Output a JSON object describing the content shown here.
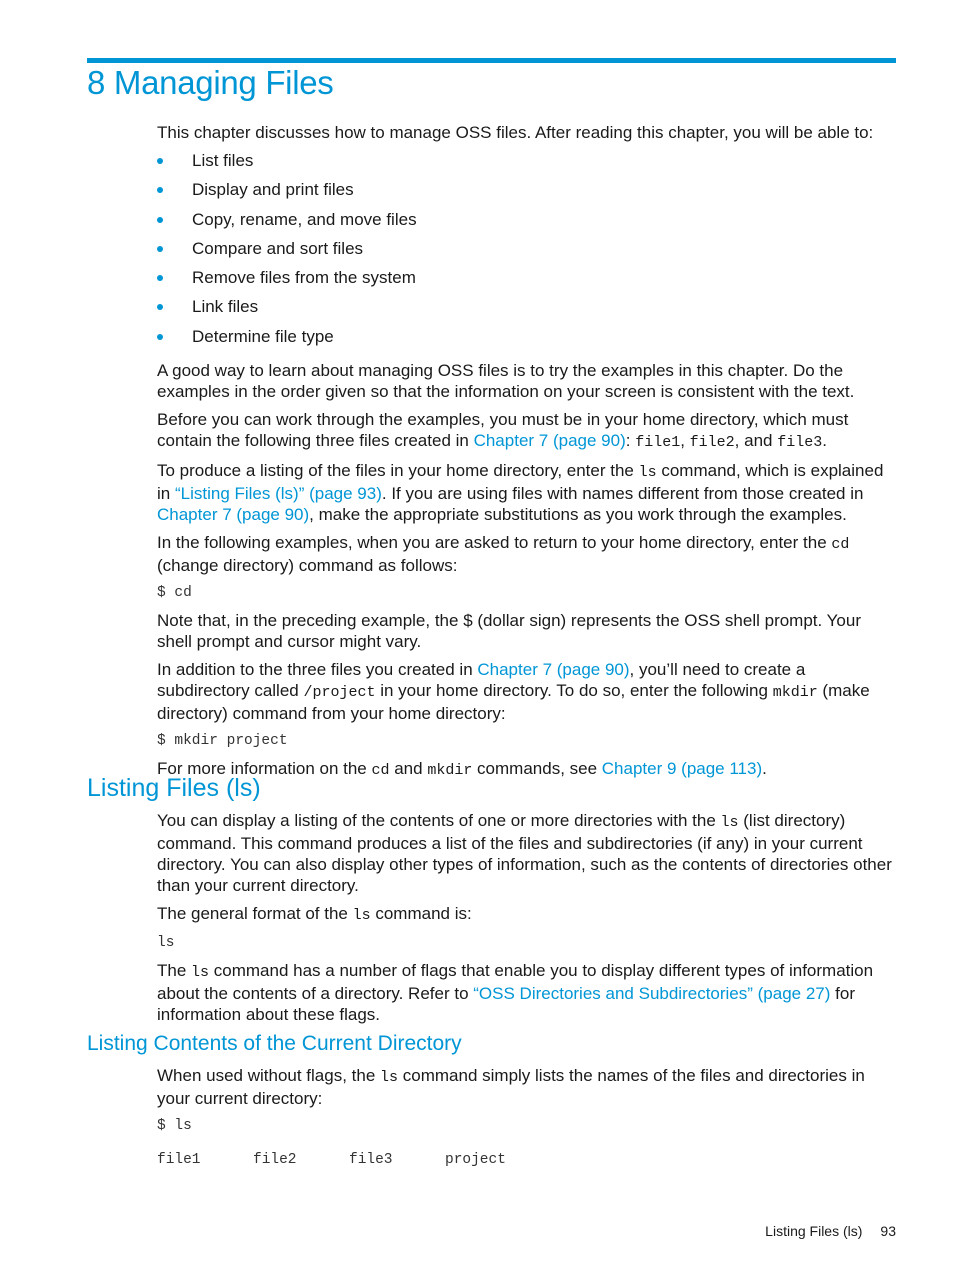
{
  "chapter": {
    "title": "8 Managing Files",
    "intro": "This chapter discusses how to manage OSS files. After reading this chapter, you will be able to:",
    "bullets": [
      "List files",
      "Display and print files",
      "Copy, rename, and move files",
      "Compare and sort files",
      "Remove files from the system",
      "Link files",
      "Determine file type"
    ],
    "p1": "A good way to learn about managing OSS files is to try the examples in this chapter. Do the examples in the order given so that the information on your screen is consistent with the text.",
    "p2": {
      "t1": "Before you can work through the examples, you must be in your home directory, which must contain the following three files created in ",
      "link1": "Chapter 7 (page 90)",
      "t2": ": ",
      "c1": "file1",
      "t3": ", ",
      "c2": "file2",
      "t4": ", and ",
      "c3": "file3",
      "t5": "."
    },
    "p3": {
      "t1": "To produce a listing of the files in your home directory, enter the ",
      "c1": "ls",
      "t2": " command, which is explained in ",
      "link1": "“Listing Files (ls)” (page 93)",
      "t3": ". If you are using files with names different from those created in ",
      "link2": "Chapter 7 (page 90)",
      "t4": ", make the appropriate substitutions as you work through the examples."
    },
    "p4": {
      "t1": "In the following examples, when you are asked to return to your home directory, enter the ",
      "c1": "cd",
      "t2": " (change directory) command as follows:"
    },
    "code1": "$ cd",
    "p5": "Note that, in the preceding example, the $ (dollar sign) represents the OSS shell prompt. Your shell prompt and cursor might vary.",
    "p6": {
      "t1": "In addition to the three files you created in ",
      "link1": "Chapter 7 (page 90)",
      "t2": ", you’ll need to create a subdirectory called ",
      "c1": "/project",
      "t3": " in your home directory. To do so, enter the following ",
      "c2": "mkdir",
      "t4": " (make directory) command from your home directory:"
    },
    "code2": "$ mkdir project",
    "p7": {
      "t1": "For more information on the ",
      "c1": "cd",
      "t2": " and ",
      "c2": "mkdir",
      "t3": " commands, see ",
      "link1": "Chapter 9 (page 113)",
      "t4": "."
    }
  },
  "section_ls": {
    "title": "Listing Files (ls)",
    "p1": {
      "t1": "You can display a listing of the contents of one or more directories with the ",
      "c1": "ls",
      "t2": " (list directory) command. This command produces a list of the files and subdirectories (if any) in your current directory. You can also display other types of information, such as the contents of directories other than your current directory."
    },
    "p2": {
      "t1": "The general format of the ",
      "c1": "ls",
      "t2": " command is:"
    },
    "code1": "ls",
    "p3": {
      "t1": "The ",
      "c1": "ls",
      "t2": " command has a number of flags that enable you to display different types of information about the contents of a directory. Refer to ",
      "link1": "“OSS Directories and Subdirectories” (page 27)",
      "t3": " for information about these flags."
    }
  },
  "section_current": {
    "title": "Listing Contents of the Current Directory",
    "p1": {
      "t1": "When used without flags, the ",
      "c1": "ls",
      "t2": " command simply lists the names of the files and directories in your current directory:"
    },
    "code1": "$ ls",
    "output": [
      "file1",
      "file2",
      "file3",
      "project"
    ]
  },
  "footer": {
    "section": "Listing Files (ls)",
    "page": "93"
  }
}
